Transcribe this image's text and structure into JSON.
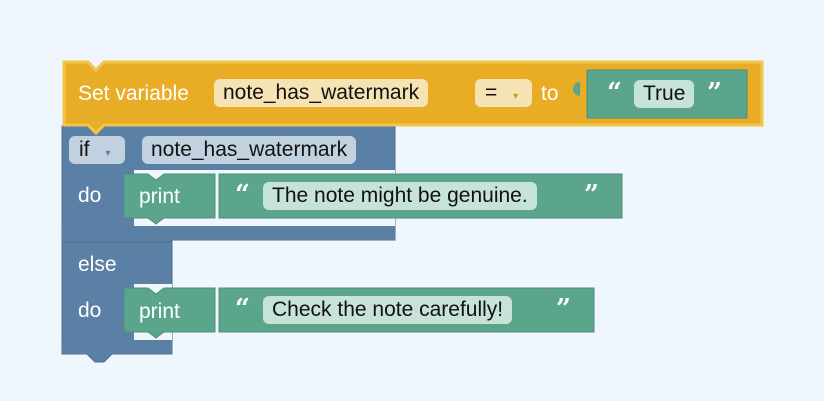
{
  "colors": {
    "background": "#f0f6fd",
    "set_block": "#e8ad25",
    "set_block_border": "#f2c64a",
    "set_field": "#f6e3b3",
    "logic_block": "#5b80a5",
    "logic_field": "#c2d1e0",
    "text_block": "#5ba58c",
    "text_field": "#c7e2d9"
  },
  "set_block": {
    "label": "Set variable",
    "variable": "note_has_watermark",
    "operator": "=",
    "to_label": "to",
    "value": "True"
  },
  "if_block": {
    "if_label": "if",
    "condition": "note_has_watermark",
    "do_label_1": "do",
    "print_label_1": "print",
    "message_1": "The note might be genuine.",
    "else_label": "else",
    "do_label_2": "do",
    "print_label_2": "print",
    "message_2": "Check the note carefully!"
  },
  "icons": {
    "open_quote": "“",
    "close_quote": "”",
    "dropdown_arrow": "▾"
  }
}
